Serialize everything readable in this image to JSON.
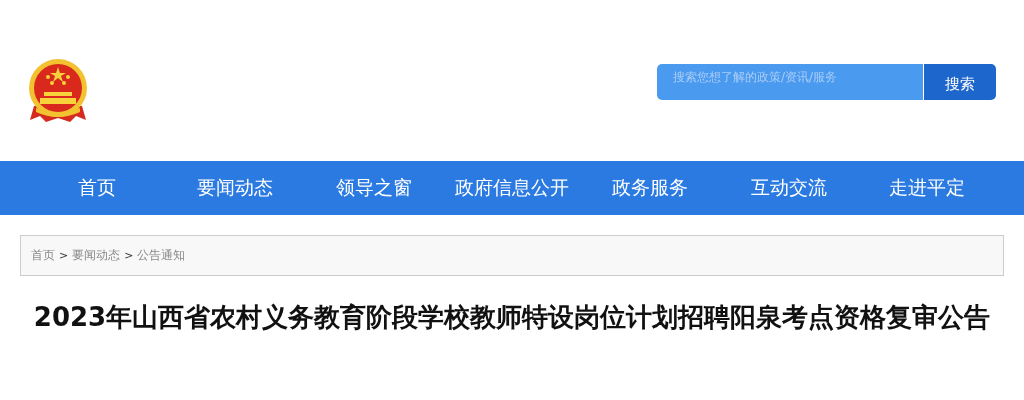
{
  "search": {
    "placeholder": "搜索您想了解的政策/资讯/服务",
    "button": "搜索"
  },
  "nav": [
    {
      "label": "首页"
    },
    {
      "label": "要闻动态"
    },
    {
      "label": "领导之窗"
    },
    {
      "label": "政府信息公开"
    },
    {
      "label": "政务服务"
    },
    {
      "label": "互动交流"
    },
    {
      "label": "走进平定"
    }
  ],
  "breadcrumb": [
    {
      "label": "首页"
    },
    {
      "label": "要闻动态"
    },
    {
      "label": "公告通知"
    }
  ],
  "breadcrumb_separator": ">",
  "article": {
    "title": "2023年山西省农村义务教育阶段学校教师特设岗位计划招聘阳泉考点资格复审公告"
  }
}
